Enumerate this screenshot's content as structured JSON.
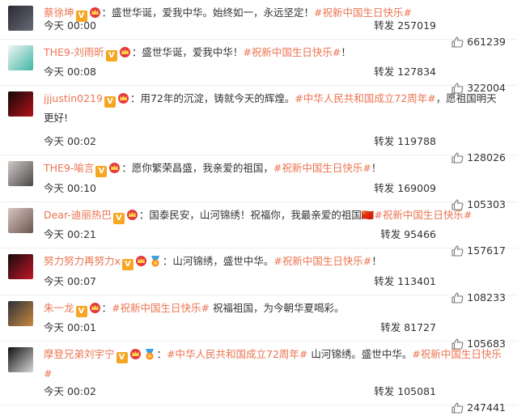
{
  "posts": [
    {
      "name": "蔡徐坤",
      "has_medal": false,
      "segments": [
        {
          "t": "：盛世华诞，爱我中华。始终如一，永远坚定！",
          "tag": false
        },
        {
          "t": "#祝新中国生日快乐#",
          "tag": true
        }
      ],
      "time": "今天 00:00",
      "repost": "转发 257019",
      "likes": "661239",
      "avatar_colors": [
        "#2a2a35",
        "#6a6a78"
      ]
    },
    {
      "name": "THE9-刘雨昕",
      "has_medal": false,
      "segments": [
        {
          "t": "：盛世华诞，爱我中华！",
          "tag": false
        },
        {
          "t": "#祝新中国生日快乐#",
          "tag": true
        },
        {
          "t": "！",
          "tag": false
        }
      ],
      "time": "今天 00:08",
      "repost": "转发 127834",
      "likes": "322004",
      "avatar_colors": [
        "#f2f5f4",
        "#3fb7a4"
      ]
    },
    {
      "name": "jjjustin0219",
      "has_medal": false,
      "segments": [
        {
          "t": "：用72年的沉淀，铸就今天的辉煌。",
          "tag": false
        },
        {
          "t": "#中华人民共和国成立72周年#",
          "tag": true
        },
        {
          "t": "，愿祖国明天更好!",
          "tag": false
        }
      ],
      "time": "今天 00:02",
      "repost": "转发 119788",
      "likes": "128026",
      "avatar_colors": [
        "#120808",
        "#b3121c"
      ]
    },
    {
      "name": "THE9-喻言",
      "has_medal": false,
      "segments": [
        {
          "t": "：愿你繁荣昌盛，我亲爱的祖国，",
          "tag": false
        },
        {
          "t": "#祝新中国生日快乐#",
          "tag": true
        },
        {
          "t": "！",
          "tag": false
        }
      ],
      "time": "今天 00:10",
      "repost": "转发 169009",
      "likes": "105303",
      "avatar_colors": [
        "#cfcbc8",
        "#4c4748"
      ]
    },
    {
      "name": "Dear-迪丽热巴",
      "has_medal": false,
      "segments": [
        {
          "t": "：国泰民安，山河锦绣！祝福你，我最亲爱的祖国🇨🇳",
          "tag": false
        },
        {
          "t": "#祝新中国生日快乐#",
          "tag": true
        }
      ],
      "time": "今天 00:21",
      "repost": "转发 95466",
      "likes": "157617",
      "avatar_colors": [
        "#d9c6c0",
        "#6b5550"
      ]
    },
    {
      "name": "努力努力再努力x",
      "has_medal": true,
      "segments": [
        {
          "t": "：山河锦绣，盛世中华。",
          "tag": false
        },
        {
          "t": "#祝新中国生日快乐#",
          "tag": true
        },
        {
          "t": "！",
          "tag": false
        }
      ],
      "time": "今天 00:07",
      "repost": "转发 113401",
      "likes": "108233",
      "avatar_colors": [
        "#160a0a",
        "#c0182a"
      ]
    },
    {
      "name": "朱一龙",
      "has_medal": false,
      "segments": [
        {
          "t": "：",
          "tag": false
        },
        {
          "t": "#祝新中国生日快乐#",
          "tag": true
        },
        {
          "t": " 祝福祖国，为今朝华夏喝彩。",
          "tag": false
        }
      ],
      "time": "今天 00:01",
      "repost": "转发 81727",
      "likes": "105683",
      "avatar_colors": [
        "#2b2f3a",
        "#c98a3f"
      ]
    },
    {
      "name": "摩登兄弟刘宇宁",
      "has_medal": true,
      "segments": [
        {
          "t": "：",
          "tag": false
        },
        {
          "t": "#中华人民共和国成立72周年#",
          "tag": true
        },
        {
          "t": " 山河锦绣。盛世中华。",
          "tag": false
        },
        {
          "t": "#祝新中国生日快乐#",
          "tag": true
        }
      ],
      "time": "今天 00:02",
      "repost": "转发 105081",
      "likes": "247441",
      "avatar_colors": [
        "#101010",
        "#d8d8d8"
      ]
    }
  ]
}
